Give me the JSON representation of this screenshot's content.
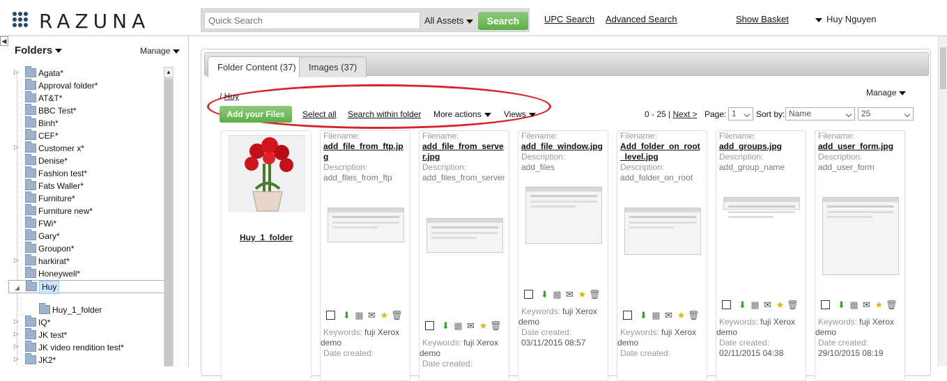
{
  "brand": {
    "logo_text": "RAZUNA"
  },
  "search": {
    "placeholder": "Quick Search",
    "scope": "All Assets",
    "button": "Search"
  },
  "header_links": {
    "upc": "UPC Search",
    "advanced": "Advanced Search",
    "basket": "Show Basket",
    "user": "Huy Nguyen"
  },
  "sidebar": {
    "title": "Folders",
    "manage": "Manage",
    "folders": [
      {
        "label": "Agata*"
      },
      {
        "label": "Approval folder*"
      },
      {
        "label": "AT&T*"
      },
      {
        "label": "BBC Test*"
      },
      {
        "label": "Binh*"
      },
      {
        "label": "CEF*"
      },
      {
        "label": "Customer x*"
      },
      {
        "label": "Denise*"
      },
      {
        "label": "Fashion test*"
      },
      {
        "label": "Fats Waller*"
      },
      {
        "label": "Furniture*"
      },
      {
        "label": "Furniture new*"
      },
      {
        "label": "FWi*"
      },
      {
        "label": "Gary*"
      },
      {
        "label": "Groupon*"
      },
      {
        "label": "harkirat*"
      },
      {
        "label": "Honeywell*"
      },
      {
        "label": "Huy"
      },
      {
        "label": "Huy_1_folder"
      },
      {
        "label": "IQ*"
      },
      {
        "label": "JK test*"
      },
      {
        "label": "JK video rendition test*"
      },
      {
        "label": "JK2*"
      }
    ]
  },
  "tabs": [
    {
      "label": "Folder Content (37)"
    },
    {
      "label": "Images (37)"
    }
  ],
  "breadcrumb": {
    "sep": "/ ",
    "current": "Huy"
  },
  "toolbar": {
    "manage": "Manage",
    "add": "Add your Files",
    "select_all": "Select all",
    "search_within": "Search within folder",
    "more": "More actions",
    "views": "Views"
  },
  "pager": {
    "range": "0 - 25 |",
    "next": "Next >",
    "page_label": "Page:",
    "page": "1",
    "sort_label": "Sort by:",
    "sort": "Name",
    "per_page": "25"
  },
  "folder_card": {
    "name": "Huy_1_folder"
  },
  "labels": {
    "filename": "Filename:",
    "description": "Description:",
    "keywords": "Keywords:",
    "date_created": "Date created:"
  },
  "assets": [
    {
      "filename": "add_file_from_ftp.jpg",
      "description": "add_files_from_ftp",
      "keywords": "fuji Xerox demo",
      "date": ""
    },
    {
      "filename": "add_file_from_server.jpg",
      "description": "add_files_from_server",
      "keywords": "fuji Xerox demo",
      "date": ""
    },
    {
      "filename": "add_file_window.jpg",
      "description": "add_files",
      "keywords": "fuji Xerox demo",
      "date": "03/11/2015 08:57"
    },
    {
      "filename": "Add_folder_on_root_level.jpg",
      "description": "add_folder_on_root",
      "keywords": "fuji Xerox demo",
      "date": ""
    },
    {
      "filename": "add_groups.jpg",
      "description": "add_group_name",
      "keywords": "fuji Xerox demo",
      "date": "02/11/2015 04:38"
    },
    {
      "filename": "add_user_form.jpg",
      "description": "add_user_form",
      "keywords": "fuji Xerox demo",
      "date": "29/10/2015 08:19"
    }
  ],
  "colors": {
    "accent_green": "#6ab24f",
    "annotation_red": "#d9252a",
    "logo_blue": "#244a6e"
  }
}
